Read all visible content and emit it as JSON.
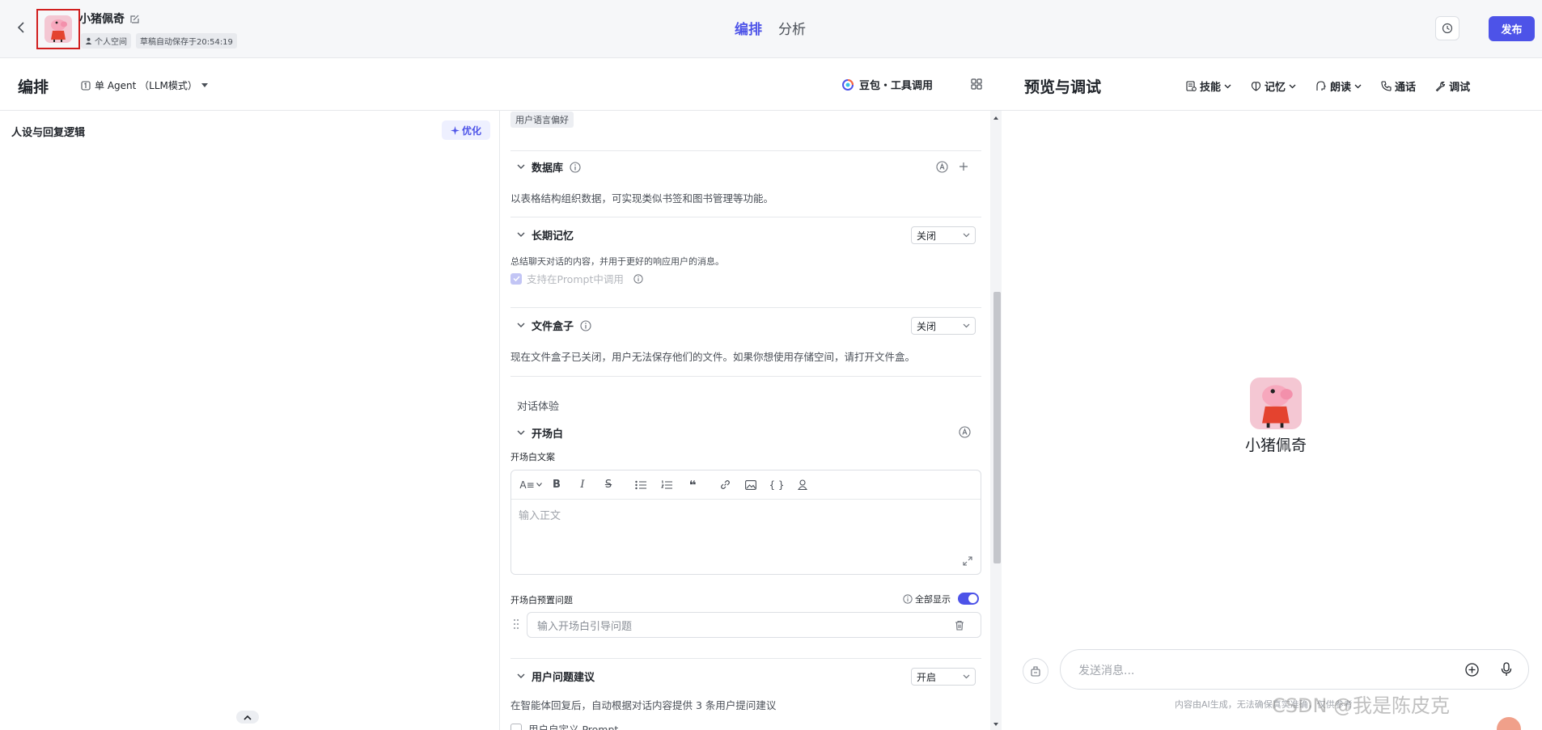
{
  "topbar": {
    "bot_name": "小猪佩奇",
    "space_label": "个人空间",
    "autosave_label": "草稿自动保存于20:54:19",
    "tabs": [
      {
        "label": "编排",
        "active": true
      },
      {
        "label": "分析",
        "active": false
      }
    ],
    "publish_label": "发布",
    "accent_color": "#4d53e8"
  },
  "edit_header": {
    "title": "编排",
    "agent_mode": "单 Agent （LLM模式）",
    "model_label": "豆包・工具调用"
  },
  "left": {
    "persona_title": "人设与回复逻辑",
    "optimize_label": "优化"
  },
  "middle": {
    "top_tag": "用户语言偏好",
    "database": {
      "title": "数据库",
      "desc": "以表格结构组织数据，可实现类似书签和图书管理等功能。"
    },
    "long_memory": {
      "title": "长期记忆",
      "select_value": "关闭",
      "desc": "总结聊天对话的内容，并用于更好的响应用户的消息。",
      "checkbox_label": "支持在Prompt中调用"
    },
    "file_box": {
      "title": "文件盒子",
      "select_value": "关闭",
      "desc": "现在文件盒子已关闭，用户无法保存他们的文件。如果你想使用存储空间，请打开文件盒。"
    },
    "dialog_group_label": "对话体验",
    "opening": {
      "title": "开场白",
      "copy_label": "开场白文案",
      "toolbar_font": "A≡",
      "editor_placeholder": "输入正文",
      "preset_label": "开场白预置问题",
      "show_all_label": "全部显示",
      "show_all_on": true,
      "question_placeholder": "输入开场白引导问题"
    },
    "suggestions": {
      "title": "用户问题建议",
      "select_value": "开启",
      "desc": "在智能体回复后，自动根据对话内容提供 3 条用户提问建议",
      "custom_prompt_label": "用户自定义 Prompt"
    }
  },
  "right": {
    "title": "预览与调试",
    "tools": [
      "技能",
      "记忆",
      "朗读",
      "通话",
      "调试"
    ],
    "bot_name": "小猪佩奇",
    "input_placeholder": "发送消息...",
    "disclaimer": "内容由AI生成，无法确保真实准确，仅供参考",
    "watermark": "CSDN @我是陈皮克"
  }
}
